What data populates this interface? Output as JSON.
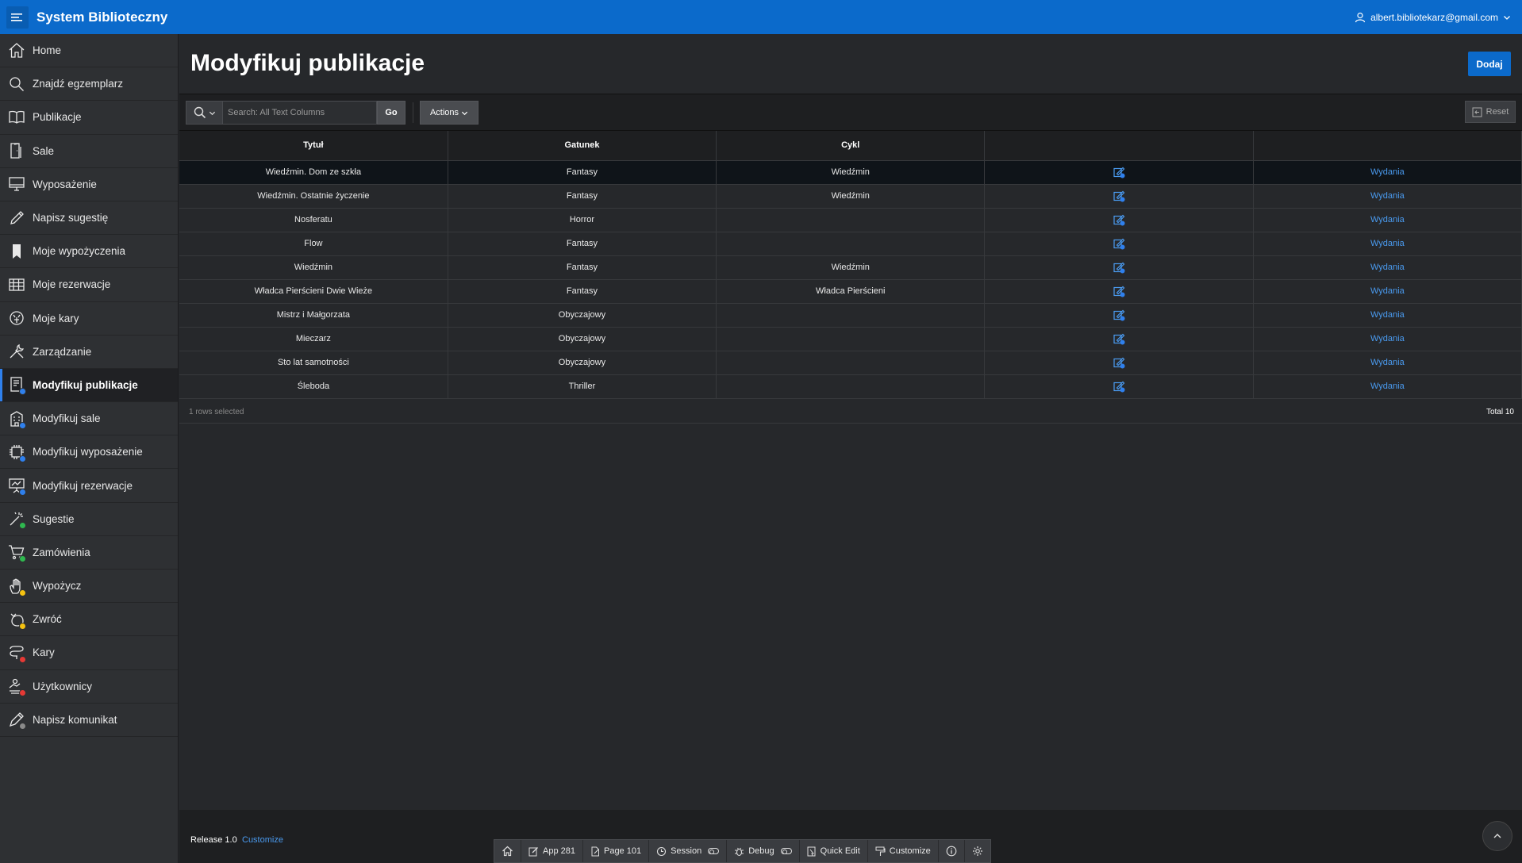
{
  "header": {
    "app_title": "System Biblioteczny",
    "user_email": "albert.bibliotekarz@gmail.com"
  },
  "sidebar": {
    "items": [
      {
        "label": "Home",
        "icon": "home-icon"
      },
      {
        "label": "Znajdź egzemplarz",
        "icon": "search-icon"
      },
      {
        "label": "Publikacje",
        "icon": "book-icon"
      },
      {
        "label": "Sale",
        "icon": "door-icon"
      },
      {
        "label": "Wyposażenie",
        "icon": "monitor-icon"
      },
      {
        "label": "Napisz sugestię",
        "icon": "pencil-icon"
      },
      {
        "label": "Moje wypożyczenia",
        "icon": "bookmark-icon"
      },
      {
        "label": "Moje rezerwacje",
        "icon": "table-icon"
      },
      {
        "label": "Moje kary",
        "icon": "money-icon"
      },
      {
        "label": "Zarządzanie",
        "icon": "wrench-icon"
      },
      {
        "label": "Modyfikuj publikacje",
        "icon": "book-edit-icon",
        "badge": "#2f80ed"
      },
      {
        "label": "Modyfikuj sale",
        "icon": "building-edit-icon",
        "badge": "#2f80ed"
      },
      {
        "label": "Modyfikuj wyposażenie",
        "icon": "chip-edit-icon",
        "badge": "#2f80ed"
      },
      {
        "label": "Modyfikuj rezerwacje",
        "icon": "presentation-edit-icon",
        "badge": "#2f80ed"
      },
      {
        "label": "Sugestie",
        "icon": "wand-icon",
        "badge": "#2fb84f"
      },
      {
        "label": "Zamówienia",
        "icon": "cart-icon",
        "badge": "#2fb84f"
      },
      {
        "label": "Wypożycz",
        "icon": "hand-icon",
        "badge": "#f5c211"
      },
      {
        "label": "Zwróć",
        "icon": "return-icon",
        "badge": "#f5c211"
      },
      {
        "label": "Kary",
        "icon": "penalty-icon",
        "badge": "#e53935"
      },
      {
        "label": "Użytkownicy",
        "icon": "users-icon",
        "badge": "#e53935"
      },
      {
        "label": "Napisz komunikat",
        "icon": "pen-message-icon",
        "badge": "#8a8a8a"
      }
    ],
    "active_index": 10
  },
  "page": {
    "title": "Modyfikuj publikacje",
    "add_button": "Dodaj"
  },
  "toolbar": {
    "search_placeholder": "Search: All Text Columns",
    "go_label": "Go",
    "actions_label": "Actions",
    "reset_label": "Reset"
  },
  "table": {
    "columns": [
      "Tytuł",
      "Gatunek",
      "Cykl",
      "",
      ""
    ],
    "link_label": "Wydania",
    "rows": [
      {
        "tytul": "Wiedźmin. Dom ze szkła",
        "gatunek": "Fantasy",
        "cykl": "Wiedźmin",
        "selected": true
      },
      {
        "tytul": "Wiedźmin. Ostatnie życzenie",
        "gatunek": "Fantasy",
        "cykl": "Wiedźmin"
      },
      {
        "tytul": "Nosferatu",
        "gatunek": "Horror",
        "cykl": ""
      },
      {
        "tytul": "Flow",
        "gatunek": "Fantasy",
        "cykl": ""
      },
      {
        "tytul": "Wiedźmin",
        "gatunek": "Fantasy",
        "cykl": "Wiedźmin"
      },
      {
        "tytul": "Władca Pierścieni Dwie Wieże",
        "gatunek": "Fantasy",
        "cykl": "Władca Pierścieni"
      },
      {
        "tytul": "Mistrz i Małgorzata",
        "gatunek": "Obyczajowy",
        "cykl": ""
      },
      {
        "tytul": "Mieczarz",
        "gatunek": "Obyczajowy",
        "cykl": ""
      },
      {
        "tytul": "Sto lat samotności",
        "gatunek": "Obyczajowy",
        "cykl": ""
      },
      {
        "tytul": "Śleboda",
        "gatunek": "Thriller",
        "cykl": ""
      }
    ],
    "rows_selected": "1 rows selected",
    "total": "Total 10"
  },
  "footer": {
    "release": "Release 1.0",
    "customize": "Customize"
  },
  "dev_toolbar": {
    "app": "App 281",
    "page": "Page 101",
    "session": "Session",
    "debug": "Debug",
    "quick_edit": "Quick Edit",
    "customize": "Customize"
  },
  "colors": {
    "header": "#0b6acb",
    "sidebar": "#2e3033",
    "link": "#4a9bf0",
    "active_marker": "#2f80ed"
  }
}
